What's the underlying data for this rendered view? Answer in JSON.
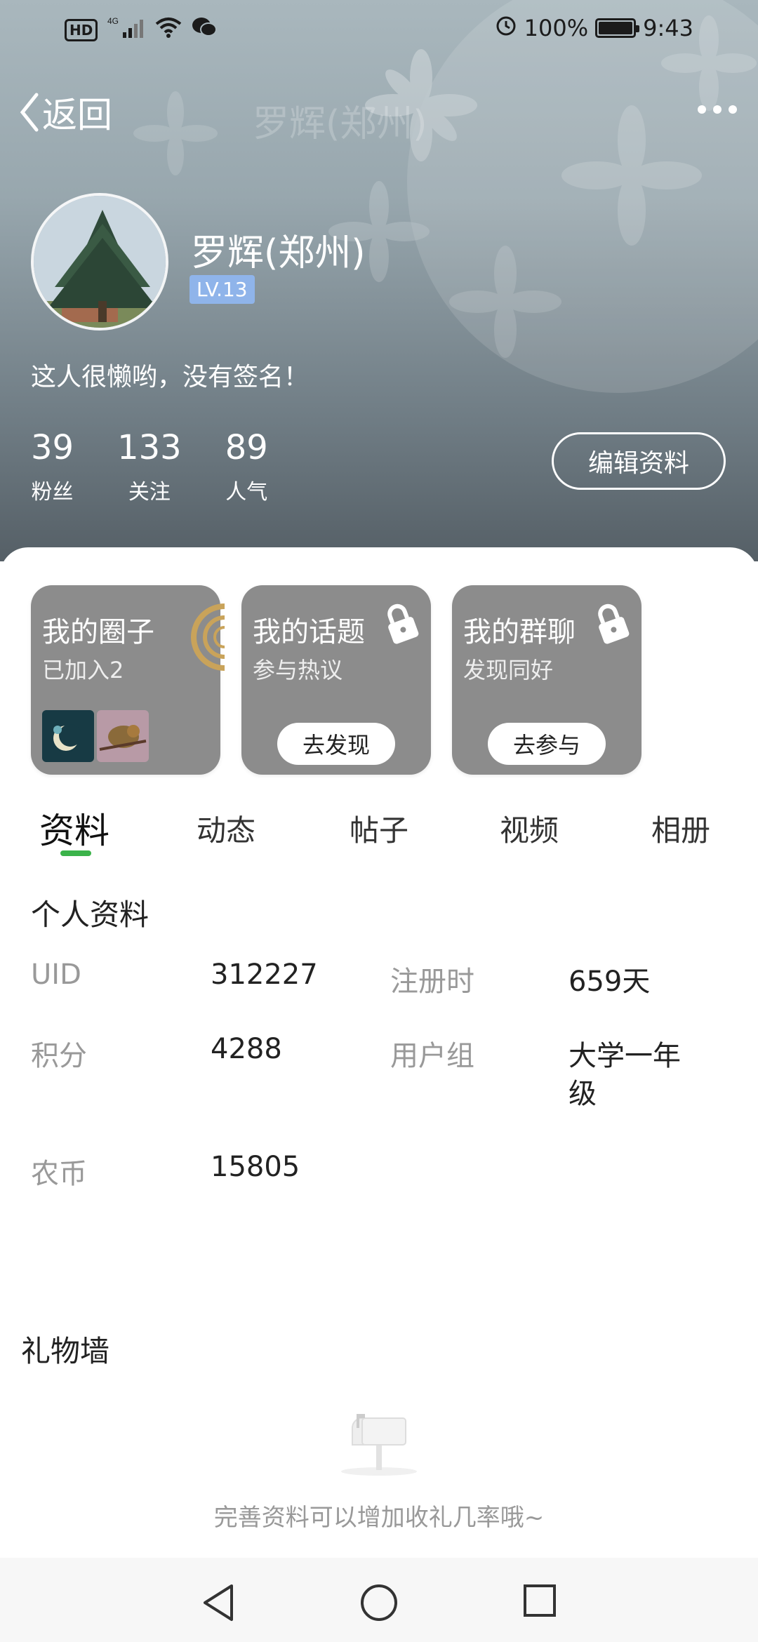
{
  "status_bar": {
    "hd": "HD",
    "network": "4G",
    "battery": "100%",
    "time": "9:43"
  },
  "nav": {
    "back_label": "返回",
    "ghost_title": "罗辉(郑州)"
  },
  "profile": {
    "name": "罗辉(郑州)",
    "level": "LV.13",
    "signature": "这人很懒哟，没有签名！",
    "stats": [
      {
        "value": "39",
        "label": "粉丝"
      },
      {
        "value": "133",
        "label": "关注"
      },
      {
        "value": "89",
        "label": "人气"
      }
    ],
    "edit_label": "编辑资料"
  },
  "tiles": [
    {
      "title": "我的圈子",
      "subtitle": "已加入2"
    },
    {
      "title": "我的话题",
      "subtitle": "参与热议",
      "action": "去发现"
    },
    {
      "title": "我的群聊",
      "subtitle": "发现同好",
      "action": "去参与"
    }
  ],
  "tabs": [
    "资料",
    "动态",
    "帖子",
    "视频",
    "相册"
  ],
  "profile_info": {
    "section_title": "个人资料",
    "fields": [
      {
        "label": "UID",
        "value": "312227"
      },
      {
        "label": "注册时",
        "value": "659天"
      },
      {
        "label": "积分",
        "value": "4288"
      },
      {
        "label": "用户组",
        "value_line1": "大学一年",
        "value_line2": "级"
      },
      {
        "label": "农币",
        "value": "15805"
      }
    ]
  },
  "gift_wall": {
    "title": "礼物墙",
    "empty_text": "完善资料可以增加收礼几率哦~"
  },
  "colors": {
    "accent": "#3bb34a",
    "level_badge": "#8fb4ea",
    "tile_bg": "#8c8c8c"
  }
}
